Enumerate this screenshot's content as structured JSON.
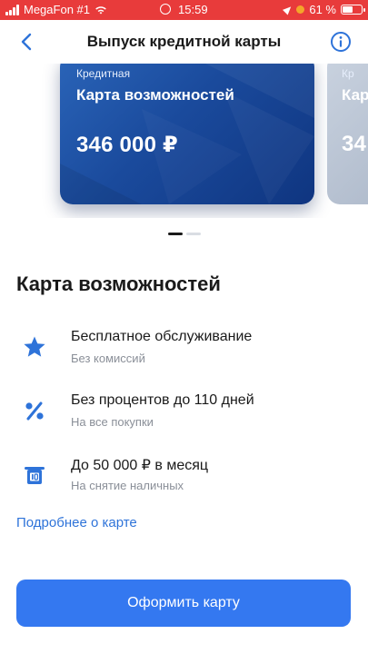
{
  "status_bar": {
    "carrier": "MegaFon #1",
    "time": "15:59",
    "battery_percent": "61 %",
    "battery_level": 0.61
  },
  "nav": {
    "title": "Выпуск кредитной карты"
  },
  "cards": [
    {
      "type": "Кредитная",
      "name": "Карта возможностей",
      "limit": "346 000 ₽"
    },
    {
      "type": "Кр",
      "name": "Кар",
      "limit": "34"
    }
  ],
  "carousel": {
    "page_count": 2,
    "active_index": 0
  },
  "section": {
    "title": "Карта возможностей"
  },
  "features": [
    {
      "icon": "star-icon",
      "title": "Бесплатное обслуживание",
      "subtitle": "Без комиссий"
    },
    {
      "icon": "percent-icon",
      "title": "Без процентов до 110 дней",
      "subtitle": "На все покупки"
    },
    {
      "icon": "cash-icon",
      "title": "До 50 000 ₽ в месяц",
      "subtitle": "На снятие наличных"
    }
  ],
  "more_link": "Подробнее о карте",
  "cta_label": "Оформить карту",
  "colors": {
    "status_bar": "#e83b3b",
    "accent": "#2e73d9",
    "button": "#3478f0",
    "card": "#1a4a9c"
  }
}
